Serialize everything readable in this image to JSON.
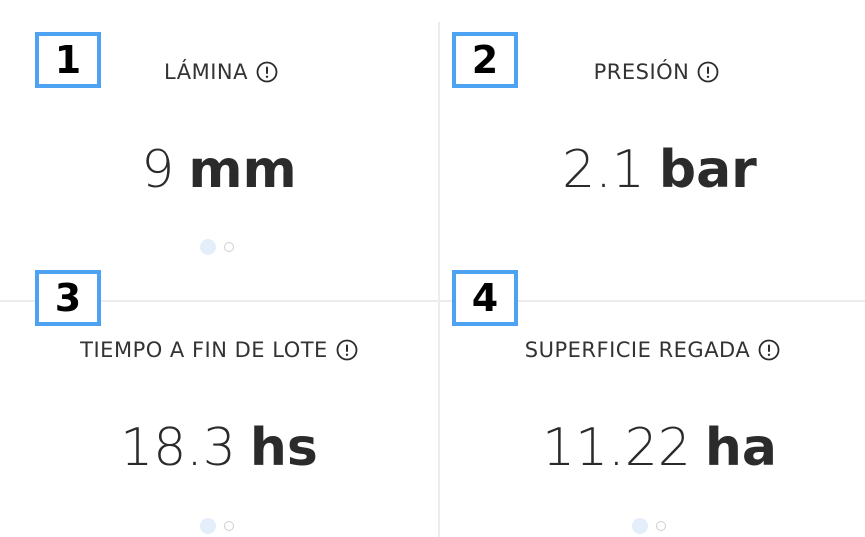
{
  "cards": [
    {
      "badge": "1",
      "title": "LÁMINA",
      "info_icon": "info-circle-icon",
      "value": "9",
      "unit": "mm",
      "pagination": {
        "total": 2,
        "active": 1
      }
    },
    {
      "badge": "2",
      "title": "PRESIÓN",
      "info_icon": "info-circle-icon",
      "value": "2.1",
      "unit": "bar"
    },
    {
      "badge": "3",
      "title": "TIEMPO A FIN DE LOTE",
      "info_icon": "info-circle-icon",
      "value": "18.3",
      "unit": "hs",
      "pagination": {
        "total": 2,
        "active": 1
      }
    },
    {
      "badge": "4",
      "title": "SUPERFICIE REGADA",
      "info_icon": "info-circle-icon",
      "value": "11.22",
      "unit": "ha",
      "pagination": {
        "total": 2,
        "active": 1
      }
    }
  ],
  "colors": {
    "badge_border": "#4da3f2",
    "dot_active": "#e3eefa",
    "text": "#2b2b2b"
  }
}
